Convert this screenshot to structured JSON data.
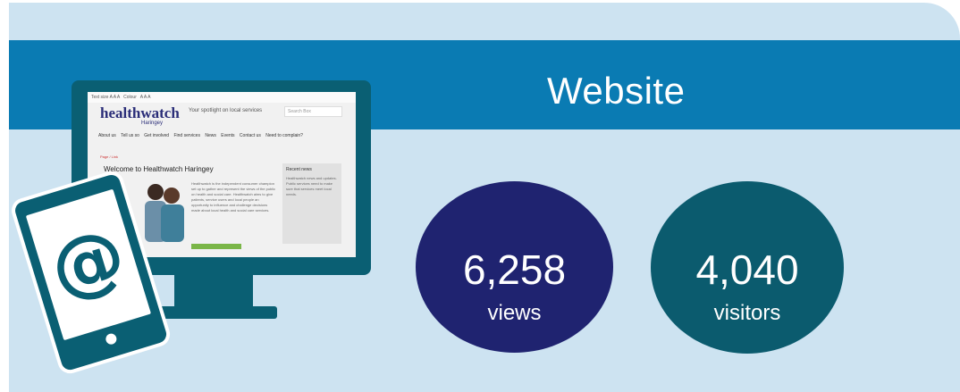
{
  "header": {
    "title": "Website"
  },
  "stats": [
    {
      "value": "6,258",
      "label": "views",
      "color": "#1f2370"
    },
    {
      "value": "4,040",
      "label": "visitors",
      "color": "#0b5b6e"
    }
  ],
  "colors": {
    "panel_bg": "#cde3f1",
    "header_band": "#0a7bb3",
    "device": "#0a5f73"
  },
  "illustration": {
    "phone_icon": "at-sign-icon",
    "monitor_icon": "desktop-monitor-icon",
    "screen": {
      "logo": "healthwatch",
      "logo_sub": "Haringey",
      "tagline": "Your spotlight on local services",
      "search_placeholder": "Search Box",
      "nav": [
        "About us",
        "Tell us so",
        "Get involved",
        "Find services",
        "News",
        "Events",
        "Contact us",
        "Need to complain?"
      ],
      "welcome": "Welcome to Healthwatch Haringey",
      "side_title": "Recent news"
    }
  }
}
